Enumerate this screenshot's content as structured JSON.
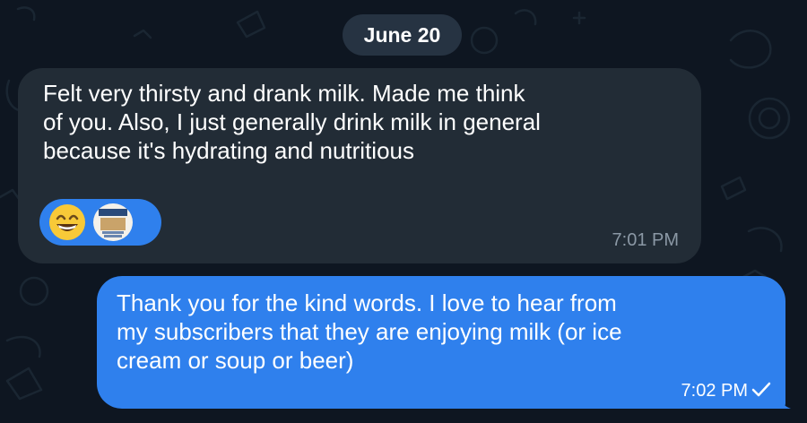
{
  "date_separator": "June 20",
  "messages": [
    {
      "direction": "incoming",
      "text": "Felt very thirsty and drank milk. Made me think\nof you. Also, I just generally drink milk in general\nbecause it's hydrating and nutritious",
      "time": "7:01 PM",
      "reaction": {
        "emoji_icon": "grinning-face-with-smiling-eyes",
        "avatar_icon": "milk-carton-avatar"
      }
    },
    {
      "direction": "outgoing",
      "text": "Thank you for the kind words. I love to hear from\nmy subscribers that they are enjoying milk (or ice\ncream or soup or beer)",
      "time": "7:02 PM",
      "status_icon": "check-icon"
    }
  ],
  "colors": {
    "background": "#0e1621",
    "incoming_bubble": "#222c36",
    "outgoing_bubble": "#2f80ed",
    "date_pill": "#263342",
    "incoming_time": "#8b98a5"
  }
}
